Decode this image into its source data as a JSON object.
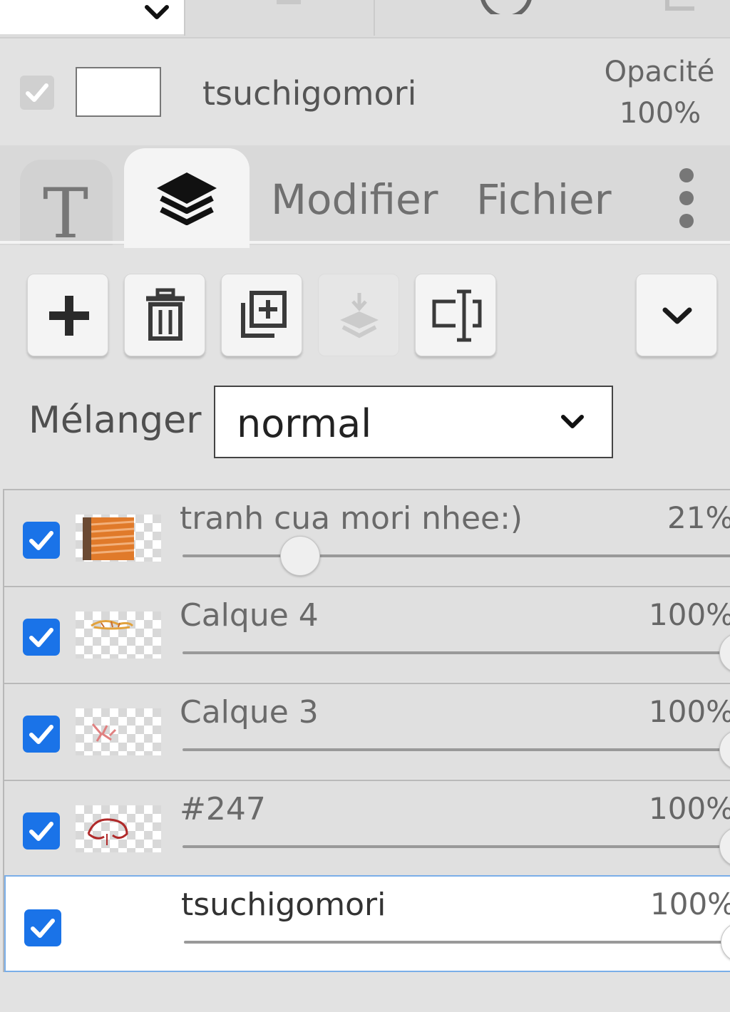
{
  "top": {
    "chevron_icon": "chevron-down-icon",
    "icons": [
      "layer-icon",
      "circle-icon",
      "page-icon"
    ]
  },
  "header": {
    "layer_name": "tsuchigomori",
    "opacity_label": "Opacité",
    "opacity_value": "100%",
    "visibility_checked": true
  },
  "tabs": {
    "text_tab": "T",
    "layers_tab_icon": "layers-icon",
    "modify": "Modifier",
    "file": "Fichier",
    "more_icon": "more-vertical-icon",
    "active": "layers"
  },
  "toolbar": {
    "buttons": [
      {
        "name": "add-layer",
        "icon": "plus-icon",
        "enabled": true
      },
      {
        "name": "delete-layer",
        "icon": "trash-icon",
        "enabled": true
      },
      {
        "name": "duplicate-layer",
        "icon": "duplicate-icon",
        "enabled": true
      },
      {
        "name": "merge-down",
        "icon": "merge-down-icon",
        "enabled": false
      },
      {
        "name": "rename-layer",
        "icon": "rename-icon",
        "enabled": true
      },
      {
        "name": "more-options",
        "icon": "chevron-down-icon",
        "enabled": true
      }
    ]
  },
  "blend": {
    "label": "Mélanger",
    "value": "normal"
  },
  "layers": [
    {
      "name": "tranh cua mori nhee:)",
      "opacity": "21%",
      "opacity_value": 0.21,
      "visible": true,
      "selected": false,
      "thumbnail": "orange-stripes"
    },
    {
      "name": "Calque 4",
      "opacity": "100%",
      "opacity_value": 1.0,
      "visible": true,
      "selected": false,
      "thumbnail": "sketch"
    },
    {
      "name": "Calque 3",
      "opacity": "100%",
      "opacity_value": 1.0,
      "visible": true,
      "selected": false,
      "thumbnail": "sketch-red"
    },
    {
      "name": "#247",
      "opacity": "100%",
      "opacity_value": 1.0,
      "visible": true,
      "selected": false,
      "thumbnail": "red-outline"
    },
    {
      "name": "tsuchigomori",
      "opacity": "100%",
      "opacity_value": 1.0,
      "visible": true,
      "selected": true,
      "thumbnail": "blank"
    }
  ],
  "colors": {
    "accent": "#1a73e8",
    "selected_border": "#7aaee8",
    "panel_bg": "#e2e2e2"
  }
}
